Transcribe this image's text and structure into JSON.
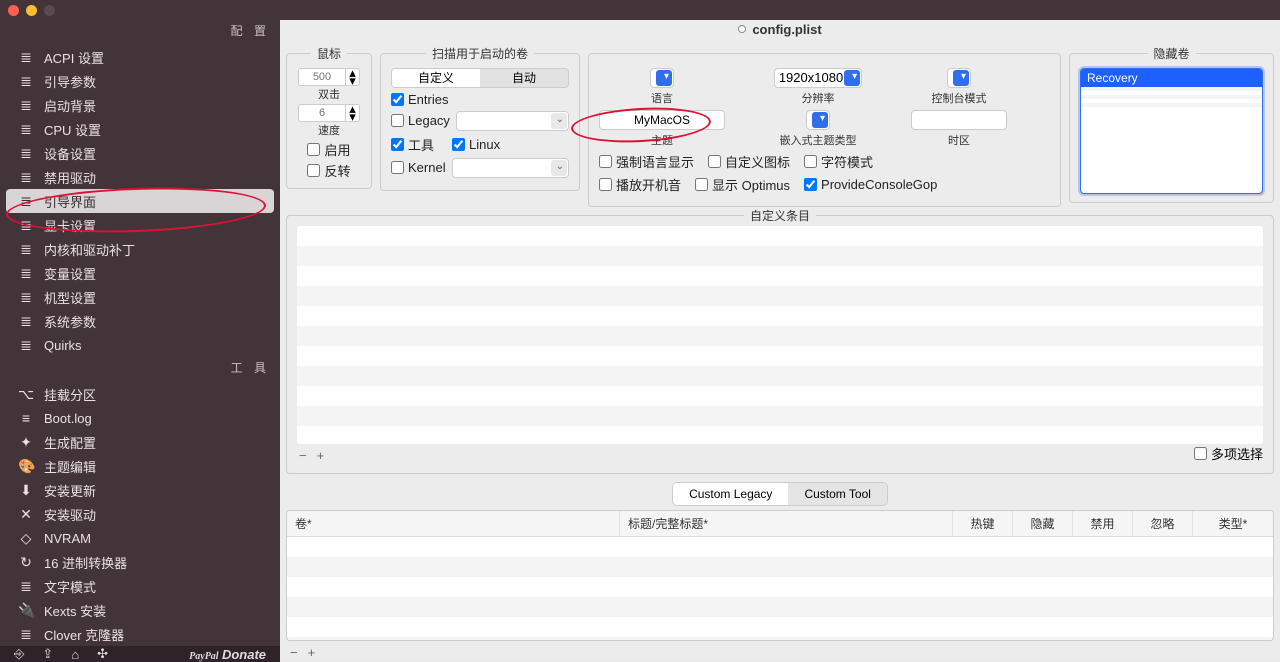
{
  "window": {
    "title": "config.plist"
  },
  "sidebar": {
    "config_label": "配  置",
    "tools_label": "工  具",
    "items": [
      {
        "icon": "≣",
        "label": "ACPI 设置"
      },
      {
        "icon": "≣",
        "label": "引导参数"
      },
      {
        "icon": "≣",
        "label": "启动背景"
      },
      {
        "icon": "≣",
        "label": "CPU 设置"
      },
      {
        "icon": "≣",
        "label": "设备设置"
      },
      {
        "icon": "≣",
        "label": "禁用驱动"
      },
      {
        "icon": "≣",
        "label": "引导界面",
        "selected": true
      },
      {
        "icon": "≣",
        "label": "显卡设置"
      },
      {
        "icon": "≣",
        "label": "内核和驱动补丁"
      },
      {
        "icon": "≣",
        "label": "变量设置"
      },
      {
        "icon": "≣",
        "label": "机型设置"
      },
      {
        "icon": "≣",
        "label": "系统参数"
      },
      {
        "icon": "≣",
        "label": "Quirks"
      }
    ],
    "tools": [
      {
        "icon": "⌥",
        "label": "挂载分区"
      },
      {
        "icon": "≡",
        "label": "Boot.log"
      },
      {
        "icon": "✦",
        "label": "生成配置"
      },
      {
        "icon": "🎨",
        "label": "主题编辑"
      },
      {
        "icon": "⬇",
        "label": "安装更新"
      },
      {
        "icon": "✕",
        "label": "安装驱动"
      },
      {
        "icon": "◇",
        "label": "NVRAM"
      },
      {
        "icon": "↻",
        "label": "16 进制转换器"
      },
      {
        "icon": "≣",
        "label": "文字模式"
      },
      {
        "icon": "🔌",
        "label": "Kexts 安装"
      },
      {
        "icon": "≣",
        "label": "Clover 克隆器"
      }
    ],
    "donate": "Donate"
  },
  "panes": {
    "mouse": {
      "title": "鼠标",
      "value": "500",
      "dbl_label": "双击",
      "speed_value": "6",
      "speed_label": "速度",
      "enable_label": "启用",
      "invert_label": "反转"
    },
    "scan": {
      "title": "扫描用于启动的卷",
      "seg_custom": "自定义",
      "seg_auto": "自动",
      "entries_label": "Entries",
      "entries_checked": true,
      "legacy_label": "Legacy",
      "tools_label": "工具",
      "tools_checked": true,
      "linux_label": "Linux",
      "linux_checked": true,
      "kernel_label": "Kernel"
    },
    "center": {
      "lang_label": "语言",
      "res_label": "分辨率",
      "res_value": "1920x1080",
      "console_label": "控制台模式",
      "theme_label": "主题",
      "theme_value": "MyMacOS",
      "embtheme_label": "嵌入式主题类型",
      "tz_label": "时区",
      "force_lang": "强制语言显示",
      "custom_icon": "自定义图标",
      "text_mode": "字符模式",
      "boot_sound": "播放开机音",
      "show_optimus": "显示 Optimus",
      "provide_gop": "ProvideConsoleGop",
      "provide_gop_checked": true
    },
    "hidden": {
      "title": "隐藏卷",
      "item1": "Recovery"
    },
    "custom_entries_title": "自定义条目",
    "multi_label": "多项选择",
    "tabs": {
      "legacy": "Custom Legacy",
      "tool": "Custom Tool"
    },
    "table": {
      "c1": "卷*",
      "c2": "标题/完整标题*",
      "c3": "热键",
      "c4": "隐藏",
      "c5": "禁用",
      "c6": "忽略",
      "c7": "类型*"
    }
  }
}
